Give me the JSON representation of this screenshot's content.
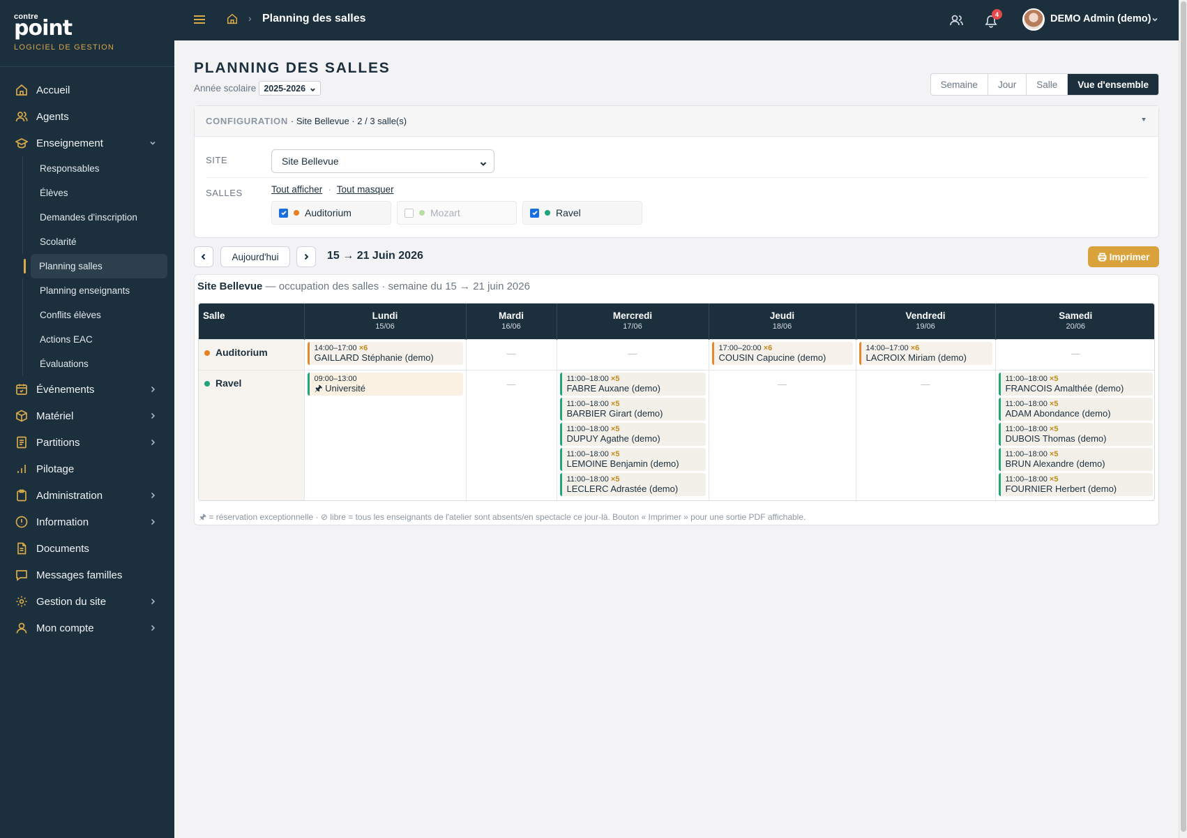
{
  "brand": {
    "small": "contre",
    "big": "point",
    "tagline": "LOGICIEL DE GESTION"
  },
  "sidebar": {
    "items": [
      {
        "label": "Accueil",
        "icon": "home-icon"
      },
      {
        "label": "Agents",
        "icon": "users-icon"
      },
      {
        "label": "Enseignement",
        "icon": "graduation-icon",
        "expanded": true
      }
    ],
    "sub_items": [
      "Responsables",
      "Élèves",
      "Demandes d'inscription",
      "Scolarité",
      "Planning salles",
      "Planning enseignants",
      "Conflits élèves",
      "Actions EAC",
      "Évaluations"
    ],
    "active_sub": "Planning salles",
    "items_after": [
      {
        "label": "Événements",
        "icon": "calendar-icon",
        "chevron": true
      },
      {
        "label": "Matériel",
        "icon": "box-icon",
        "chevron": true
      },
      {
        "label": "Partitions",
        "icon": "document-icon",
        "chevron": true
      },
      {
        "label": "Pilotage",
        "icon": "bar-chart-icon",
        "chevron": false
      },
      {
        "label": "Administration",
        "icon": "clipboard-icon",
        "chevron": true
      },
      {
        "label": "Information",
        "icon": "info-icon",
        "chevron": true
      },
      {
        "label": "Documents",
        "icon": "file-icon",
        "chevron": false
      },
      {
        "label": "Messages familles",
        "icon": "message-icon",
        "chevron": false
      },
      {
        "label": "Gestion du site",
        "icon": "gear-icon",
        "chevron": true
      },
      {
        "label": "Mon compte",
        "icon": "user-icon",
        "chevron": true
      }
    ]
  },
  "topbar": {
    "breadcrumb": "Planning des salles",
    "notifications": "4",
    "user": "DEMO Admin (demo)"
  },
  "page": {
    "title": "PLANNING DES SALLES",
    "year_label": "Année scolaire",
    "year_value": "2025-2026",
    "views": [
      "Semaine",
      "Jour",
      "Salle",
      "Vue d'ensemble"
    ],
    "active_view": "Vue d'ensemble"
  },
  "config": {
    "heading": "CONFIGURATION",
    "info": "· Site Bellevue · 2 / 3 salle(s)",
    "site_label": "SITE",
    "site_value": "Site Bellevue",
    "salles_label": "SALLES",
    "show_all": "Tout afficher",
    "hide_all": "Tout masquer",
    "rooms": [
      {
        "name": "Auditorium",
        "checked": true,
        "color": "#e8801f"
      },
      {
        "name": "Mozart",
        "checked": false,
        "color": "#a8d98c"
      },
      {
        "name": "Ravel",
        "checked": true,
        "color": "#1fa57a"
      }
    ]
  },
  "nav": {
    "today": "Aujourd'hui",
    "range": "15 → 21 Juin 2026",
    "print": "Imprimer"
  },
  "planning": {
    "caption_site": "Site Bellevue",
    "caption_rest": " — occupation des salles · semaine du 15 → 21 juin 2026",
    "header_room": "Salle",
    "days": [
      {
        "name": "Lundi",
        "date": "15/06"
      },
      {
        "name": "Mardi",
        "date": "16/06"
      },
      {
        "name": "Mercredi",
        "date": "17/06"
      },
      {
        "name": "Jeudi",
        "date": "18/06"
      },
      {
        "name": "Vendredi",
        "date": "19/06"
      },
      {
        "name": "Samedi",
        "date": "20/06"
      }
    ],
    "rooms": [
      {
        "name": "Auditorium",
        "color": "#e8801f",
        "cells": [
          [
            {
              "time": "14:00–17:00",
              "count": "×6",
              "name": "GAILLARD Stéphanie (demo)"
            }
          ],
          [],
          [],
          [
            {
              "time": "17:00–20:00",
              "count": "×6",
              "name": "COUSIN Capucine (demo)"
            }
          ],
          [
            {
              "time": "14:00–17:00",
              "count": "×6",
              "name": "LACROIX Miriam (demo)"
            }
          ],
          []
        ]
      },
      {
        "name": "Ravel",
        "color": "#1fa57a",
        "cells": [
          [
            {
              "time": "09:00–13:00",
              "count": "",
              "name": "🖈 Université",
              "special": true
            }
          ],
          [],
          [
            {
              "time": "11:00–18:00",
              "count": "×5",
              "name": "FABRE Auxane (demo)"
            },
            {
              "time": "11:00–18:00",
              "count": "×5",
              "name": "BARBIER Girart (demo)"
            },
            {
              "time": "11:00–18:00",
              "count": "×5",
              "name": "DUPUY Agathe (demo)"
            },
            {
              "time": "11:00–18:00",
              "count": "×5",
              "name": "LEMOINE Benjamin (demo)"
            },
            {
              "time": "11:00–18:00",
              "count": "×5",
              "name": "LECLERC Adrastée (demo)"
            }
          ],
          [],
          [],
          [
            {
              "time": "11:00–18:00",
              "count": "×5",
              "name": "FRANCOIS Amalthée (demo)"
            },
            {
              "time": "11:00–18:00",
              "count": "×5",
              "name": "ADAM Abondance (demo)"
            },
            {
              "time": "11:00–18:00",
              "count": "×5",
              "name": "DUBOIS Thomas (demo)"
            },
            {
              "time": "11:00–18:00",
              "count": "×5",
              "name": "BRUN Alexandre (demo)"
            },
            {
              "time": "11:00–18:00",
              "count": "×5",
              "name": "FOURNIER Herbert (demo)"
            }
          ]
        ]
      }
    ],
    "empty_mark": "—",
    "footnote": "🖈 = réservation exceptionnelle · ⊘ libre = tous les enseignants de l'atelier sont absents/en spectacle ce jour-là. Bouton « Imprimer » pour une sortie PDF affichable."
  }
}
